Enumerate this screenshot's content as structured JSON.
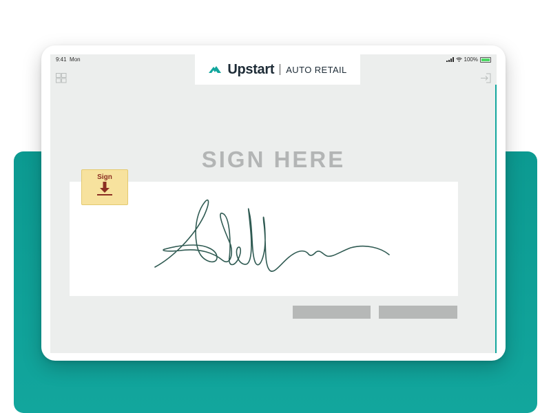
{
  "status_bar": {
    "time": "9:41",
    "day": "Mon",
    "battery": "100%"
  },
  "header": {
    "brand": "Upstart",
    "product": "AUTO RETAIL"
  },
  "main": {
    "heading": "SIGN HERE",
    "sign_tab_label": "Sign"
  },
  "icons": {
    "grid": "grid-icon",
    "exit": "exit-icon",
    "logo": "upstart-logo-icon",
    "download_arrow": "arrow-down-icon"
  },
  "colors": {
    "accent": "#12a69d",
    "brand_text": "#1d2b36",
    "signature_ink": "#2f5a52",
    "sign_tab": "#f7e29e",
    "sign_tab_text": "#8b2e22",
    "screen_bg": "#eceeed",
    "heading": "#b3b5b5",
    "button": "#b6b8b7"
  }
}
